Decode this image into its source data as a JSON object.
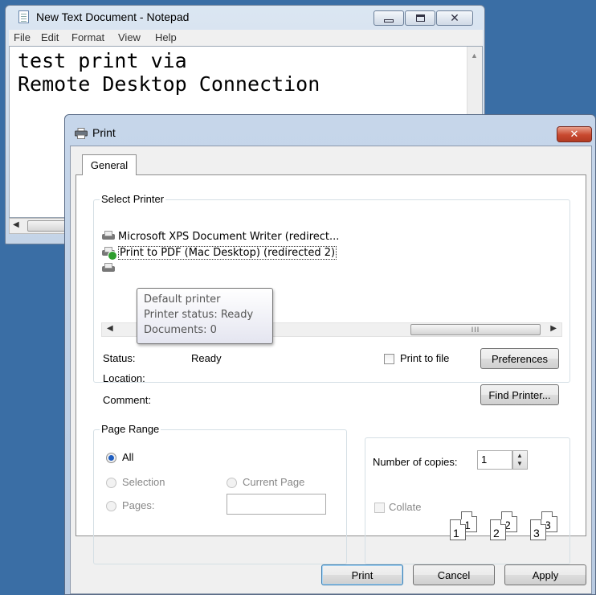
{
  "notepad": {
    "title": "New Text Document - Notepad",
    "menu": [
      "File",
      "Edit",
      "Format",
      "View",
      "Help"
    ],
    "text_lines": [
      "test print via",
      "Remote Desktop Connection"
    ]
  },
  "print_dialog": {
    "title": "Print",
    "tab": "General",
    "select_printer": {
      "legend": "Select Printer",
      "printers": [
        "Microsoft XPS Document Writer (redirect...",
        "Print to PDF (Mac Desktop) (redirected 2)"
      ],
      "tooltip": [
        "Default printer",
        "Printer status: Ready",
        "Documents: 0"
      ],
      "status_label": "Status:",
      "status_value": "Ready",
      "location_label": "Location:",
      "comment_label": "Comment:",
      "print_to_file_label": "Print to file",
      "preferences_label": "Preferences",
      "find_printer_label": "Find Printer..."
    },
    "page_range": {
      "legend": "Page Range",
      "all_label": "All",
      "selection_label": "Selection",
      "current_page_label": "Current Page",
      "pages_label": "Pages:"
    },
    "copies": {
      "label": "Number of copies:",
      "value": "1",
      "collate_label": "Collate",
      "page_numbers": [
        "1",
        "1",
        "2",
        "2",
        "3",
        "3"
      ]
    },
    "buttons": {
      "print": "Print",
      "cancel": "Cancel",
      "apply": "Apply"
    }
  },
  "colors": {
    "desktop": "#3a6ea5",
    "close_button": "#c8492f",
    "selection_radio": "#1f5ec1"
  }
}
